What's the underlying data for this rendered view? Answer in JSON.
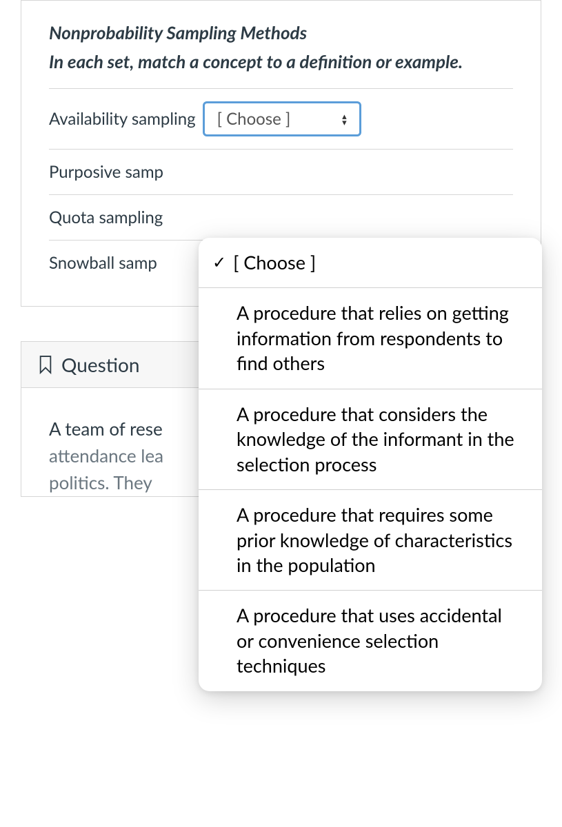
{
  "question": {
    "title": "Nonprobability Sampling Methods",
    "instruction": "In each set, match a concept to a definition or example.",
    "rows": [
      {
        "label": "Availability sampling",
        "selected": "[ Choose ]"
      },
      {
        "label": "Purposive samp"
      },
      {
        "label": "Quota sampling"
      },
      {
        "label": "Snowball samp"
      }
    ]
  },
  "dropdown": {
    "placeholder": "[ Choose ]",
    "options": [
      "A procedure that relies on getting information from respondents to find others",
      "A procedure that considers the knowledge of the informant in the selection process",
      "A procedure that requires some prior knowledge of characteristics in the population",
      "A procedure that uses accidental or convenience selection techniques"
    ]
  },
  "next_question": {
    "title": "Question",
    "body_line1": "A team of rese",
    "body_line2": "attendance lea",
    "body_line3": "politics. They"
  }
}
